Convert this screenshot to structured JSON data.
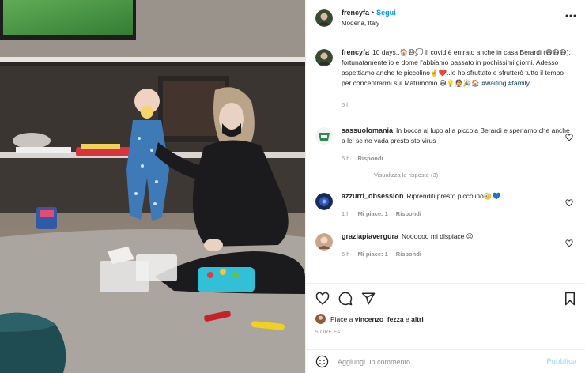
{
  "post": {
    "author": "frencyfa",
    "follow_label": "Segui",
    "separator": "•",
    "location": "Modena, Italy"
  },
  "caption": {
    "author": "frencyfa",
    "text": "10 days..🏠😷💭 Il covid è entrato anche in casa Berardi (😷😷😷). fortunatamente io e dome l'abbiamo passato in pochissimi giorni. Adesso aspettiamo anche te piccolino🤞❤️..lo ho sfruttato e sfrutterò tutto il tempo per concentrarmi sul Matrimonio.😷💡👰🎉🏠",
    "hashtags": "#waiting #family",
    "time": "5 h"
  },
  "comments": [
    {
      "author": "sassuolomania",
      "text": "In bocca al lupo alla piccola Berardi e speriamo che anche a lei se ne vada presto sto virus",
      "time": "5 h",
      "reply_label": "Rispondi",
      "replies_label": "Visualizza le risposte (3)"
    },
    {
      "author": "azzurri_obsession",
      "text": "Riprenditi presto piccolino🤕💙",
      "time": "1 h",
      "likes": "Mi piace: 1",
      "reply_label": "Rispondi"
    },
    {
      "author": "graziapiavergura",
      "text": "Noooooo mi dispiace 😔",
      "time": "5 h",
      "likes": "Mi piace: 1",
      "reply_label": "Rispondi"
    }
  ],
  "actions": {
    "like_icon": "heart-icon",
    "comment_icon": "comment-icon",
    "share_icon": "share-icon",
    "save_icon": "bookmark-icon",
    "liked_by_prefix": "Piace a",
    "liked_by_user": "vincenzo_fezza",
    "liked_by_conj": "e",
    "liked_by_others": "altri",
    "time_ago": "5 ORE FA"
  },
  "add_comment": {
    "placeholder": "Aggiungi un commento...",
    "publish_label": "Pubblica"
  },
  "colors": {
    "link_blue": "#0095f6",
    "hashtag": "#00376b",
    "muted": "#8e8e8e",
    "publish_disabled": "#b2dffc"
  }
}
